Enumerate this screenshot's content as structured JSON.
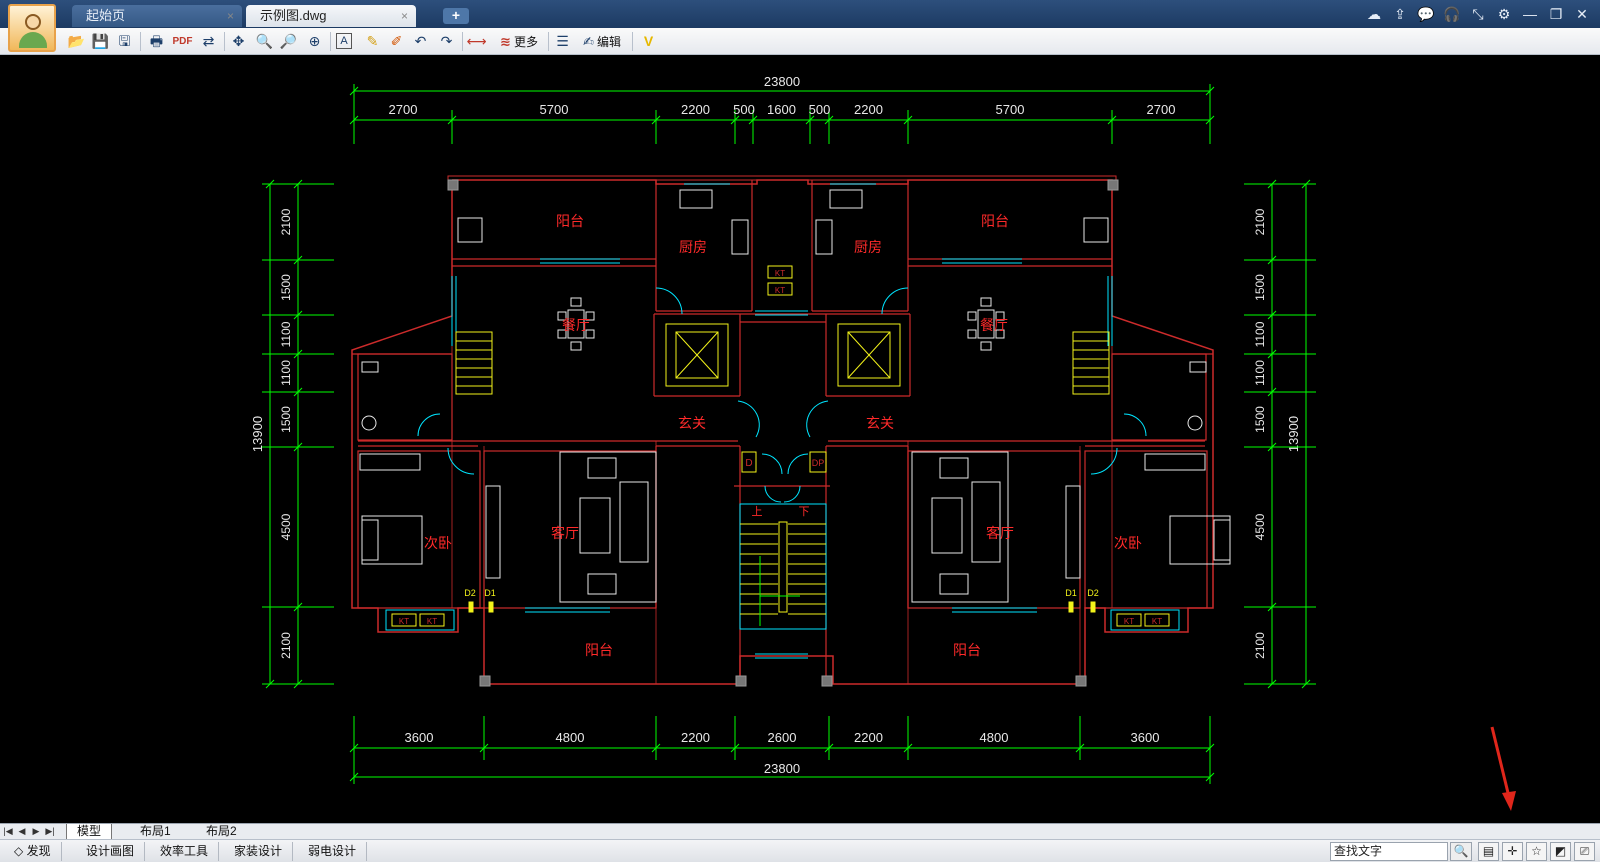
{
  "tabs": [
    {
      "label": "起始页",
      "close": "×"
    },
    {
      "label": "示例图.dwg",
      "close": "×"
    }
  ],
  "new_tab": "+",
  "window_controls": [
    "☁",
    "⇪",
    "💬",
    "🎧",
    "⤡",
    "⚙",
    "—",
    "❐",
    "✕"
  ],
  "toolbar": {
    "more_label": "更多",
    "edit_label": "编辑"
  },
  "drawing": {
    "dim_top_total": "23800",
    "dim_top": [
      "2700",
      "5700",
      "2200",
      "500",
      "1600",
      "500",
      "2200",
      "5700",
      "2700"
    ],
    "dim_bottom": [
      "3600",
      "4800",
      "2200",
      "2600",
      "2200",
      "4800",
      "3600"
    ],
    "dim_bottom_total": "23800",
    "dim_left": [
      "2100",
      "1500",
      "1100",
      "1100",
      "1500",
      "4500",
      "2100"
    ],
    "dim_left_total": "13900",
    "dim_right": [
      "2100",
      "1500",
      "1100",
      "1100",
      "1500",
      "4500",
      "2100"
    ],
    "dim_right_total": "13900",
    "rooms": {
      "balcony": "阳台",
      "kitchen": "厨房",
      "dining": "餐厅",
      "foyer": "玄关",
      "living": "客厅",
      "bedroom": "次卧",
      "up": "上",
      "down": "下"
    },
    "tags": {
      "kt": "KT",
      "d": "D",
      "dp": "DP",
      "d1": "D1",
      "d2": "D2"
    }
  },
  "layout_tabs": [
    "模型",
    "布局1",
    "布局2"
  ],
  "status": {
    "buttons": [
      "◇ 发现",
      "设计画图",
      "效率工具",
      "家装设计",
      "弱电设计"
    ],
    "search_value": "查找文字"
  }
}
